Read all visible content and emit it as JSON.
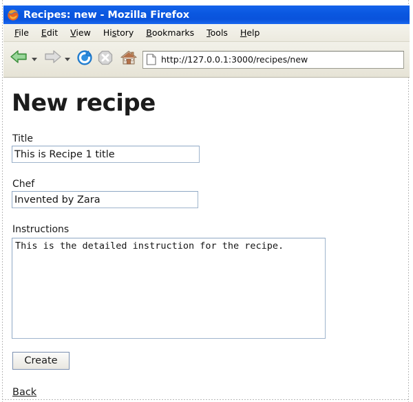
{
  "window": {
    "title": "Recipes: new - Mozilla Firefox",
    "app_icon": "firefox-logo-icon"
  },
  "menubar": {
    "items": [
      {
        "label": "File",
        "accel_index": 0
      },
      {
        "label": "Edit",
        "accel_index": 0
      },
      {
        "label": "View",
        "accel_index": 0
      },
      {
        "label": "History",
        "accel_index": 2
      },
      {
        "label": "Bookmarks",
        "accel_index": 0
      },
      {
        "label": "Tools",
        "accel_index": 0
      },
      {
        "label": "Help",
        "accel_index": 0
      }
    ]
  },
  "toolbar": {
    "back_icon": "back-arrow-icon",
    "back_dropdown_icon": "chevron-down-icon",
    "forward_icon": "forward-arrow-icon",
    "forward_dropdown_icon": "chevron-down-icon",
    "reload_icon": "reload-icon",
    "stop_icon": "stop-icon",
    "home_icon": "home-icon",
    "url_favicon": "page-document-icon",
    "url": "http://127.0.0.1:3000/recipes/new"
  },
  "page": {
    "heading": "New recipe",
    "fields": [
      {
        "name": "title",
        "label": "Title",
        "value": "This is Recipe 1 title",
        "placeholder": ""
      },
      {
        "name": "chef",
        "label": "Chef",
        "value": "Invented by Zara",
        "placeholder": ""
      },
      {
        "name": "instructions",
        "label": "Instructions",
        "value": "This is the detailed instruction for the recipe.",
        "placeholder": ""
      }
    ],
    "submit_label": "Create",
    "back_label": "Back"
  },
  "colors": {
    "titlebar_blue": "#0a57e0",
    "chrome_beige": "#eceadf",
    "input_border": "#9fb4cc",
    "button_border": "#7a8fb0",
    "text": "#1a1a1a"
  }
}
